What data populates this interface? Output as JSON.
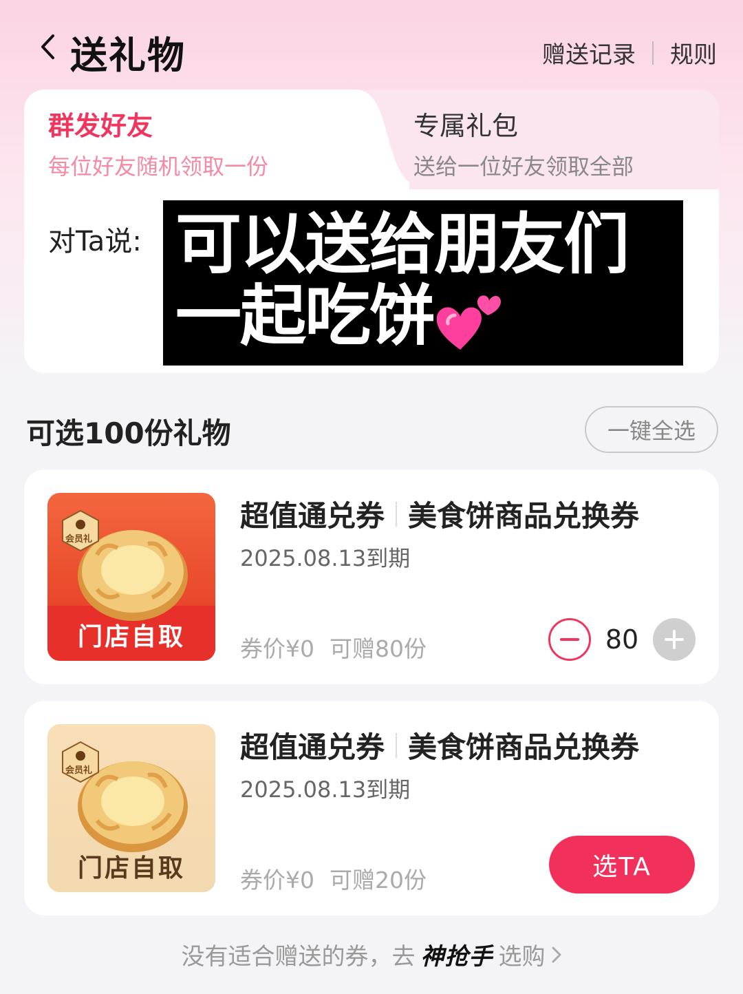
{
  "header": {
    "title": "送礼物",
    "links": [
      "赠送记录",
      "规则"
    ]
  },
  "tabs": [
    {
      "title": "群发好友",
      "subtitle": "每位好友随机领取一份",
      "active": true
    },
    {
      "title": "专属礼包",
      "subtitle": "送给一位好友领取全部",
      "active": false
    }
  ],
  "message": {
    "label": "对Ta说:",
    "overlay_line1": "可以送给朋友们",
    "overlay_line2": "一起吃饼"
  },
  "section": {
    "title": "可选100份礼物",
    "select_all": "一键全选"
  },
  "gifts": [
    {
      "type": "超值通兑券",
      "name": "美食饼商品兑换券",
      "expiry": "2025.08.13到期",
      "price": "券价¥0",
      "available": "可赠80份",
      "thumb_label": "门店自取",
      "badge": "会员礼",
      "quantity": "80",
      "state": "selected"
    },
    {
      "type": "超值通兑券",
      "name": "美食饼商品兑换券",
      "expiry": "2025.08.13到期",
      "price": "券价¥0",
      "available": "可赠20份",
      "thumb_label": "门店自取",
      "badge": "会员礼",
      "action": "选TA",
      "state": "unselected"
    }
  ],
  "footer": {
    "prefix": "没有适合赠送的券，去",
    "brand": "神抢手",
    "suffix": "选购"
  },
  "colors": {
    "accent": "#f0355f",
    "thumb_red": "#e8302a",
    "thumb_beige": "#f5d7ab"
  }
}
